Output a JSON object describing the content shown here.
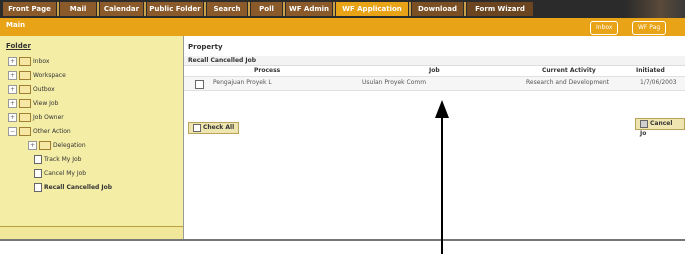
{
  "nav_tabs": [
    {
      "label": "Front Page"
    },
    {
      "label": "Mail"
    },
    {
      "label": "Calendar"
    },
    {
      "label": "Public Folder"
    },
    {
      "label": "Search"
    },
    {
      "label": "Poll"
    },
    {
      "label": "WF Admin"
    },
    {
      "label": "WF Application",
      "active": true
    },
    {
      "label": "Download"
    },
    {
      "label": "Form Wizard"
    }
  ],
  "breadcrumb": {
    "label": "Main"
  },
  "top_actions": {
    "inbox": "Inbox",
    "wf_page": "WF Pag"
  },
  "sidebar": {
    "title": "Folder",
    "items": [
      {
        "label": "Inbox"
      },
      {
        "label": "Workspace"
      },
      {
        "label": "Outbox"
      },
      {
        "label": "View Job"
      },
      {
        "label": "Job Owner"
      },
      {
        "label": "Other Action"
      },
      {
        "label": "Delegation"
      },
      {
        "label": "Track My Job"
      },
      {
        "label": "Cancel My Job"
      },
      {
        "label": "Recall Cancelled Job"
      }
    ]
  },
  "main": {
    "title": "Property",
    "subtitle": "Recall Cancelled Job",
    "columns": [
      "Process",
      "Job",
      "Current Activity",
      "Initiated"
    ],
    "rows": [
      {
        "process": "Pengajuan Proyek L",
        "job": "Usulan Proyek Comm",
        "activity": "Research and Development",
        "initiated": "1/7/06/2003"
      }
    ],
    "check_all_label": "Check All",
    "cancel_label": "Cancel Jo"
  }
}
